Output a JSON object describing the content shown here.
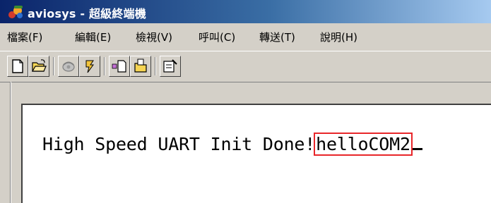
{
  "window": {
    "title": "aviosys - 超級終端機",
    "icon": "hyperterminal-app-icon"
  },
  "menu": [
    {
      "label": "檔案(F)"
    },
    {
      "label": "編輯(E)"
    },
    {
      "label": "檢視(V)"
    },
    {
      "label": "呼叫(C)"
    },
    {
      "label": "轉送(T)"
    },
    {
      "label": "說明(H)"
    }
  ],
  "toolbar": {
    "buttons": [
      "new-icon",
      "open-icon",
      "call-icon",
      "disconnect-icon",
      "send-icon",
      "receive-icon",
      "properties-icon"
    ]
  },
  "terminal": {
    "text_before": "High Speed UART Init Done!",
    "highlighted_text": "helloCOM2",
    "highlight_color": "#e8262a"
  }
}
